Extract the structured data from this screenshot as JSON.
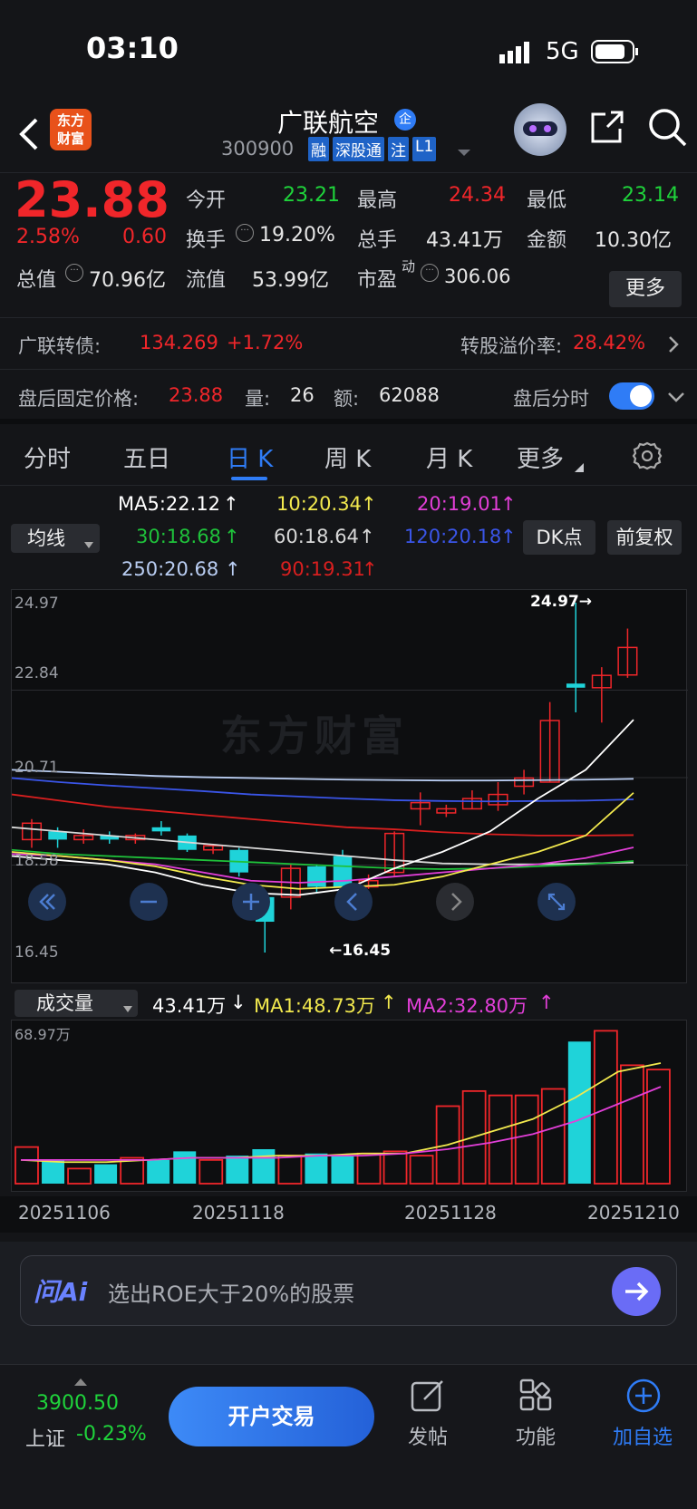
{
  "status": {
    "time": "03:10",
    "network": "5G"
  },
  "header": {
    "logo_line1": "东方",
    "logo_line2": "财富",
    "stock_name": "广联航空",
    "badge": "企",
    "code": "300900",
    "tags": [
      "融",
      "深股通",
      "注",
      "L1"
    ]
  },
  "quote": {
    "price": "23.88",
    "change_pct": "2.58%",
    "change": "0.60",
    "open_label": "今开",
    "open": "23.21",
    "high_label": "最高",
    "high": "24.34",
    "low_label": "最低",
    "low": "23.14",
    "turnover_label": "换手",
    "turnover": "19.20%",
    "volume_label": "总手",
    "volume": "43.41万",
    "amount_label": "金额",
    "amount": "10.30亿",
    "mcap_label": "总值",
    "mcap": "70.96亿",
    "float_label": "流值",
    "float": "53.99亿",
    "pe_label": "市盈",
    "pe_sup": "动",
    "pe": "306.06",
    "more": "更多"
  },
  "bond": {
    "label": "广联转债:",
    "price": "134.269",
    "pct": "+1.72%",
    "premium_label": "转股溢价率:",
    "premium": "28.42%"
  },
  "after": {
    "label": "盘后固定价格:",
    "price": "23.88",
    "vol_label": "量:",
    "vol": "26",
    "amt_label": "额:",
    "amt": "62088",
    "toggle_label": "盘后分时"
  },
  "tabs": [
    "分时",
    "五日",
    "日 K",
    "周 K",
    "月 K",
    "更多"
  ],
  "ma": {
    "selector": "均线",
    "ma5": "MA5:22.12",
    "ma10": "10:20.34",
    "ma20": "20:19.01",
    "ma30": "30:18.68",
    "ma60": "60:18.64",
    "ma120": "120:20.18",
    "ma250": "250:20.68",
    "ma90": "90:19.31",
    "dk": "DK点",
    "adjust": "前复权"
  },
  "kaxis": {
    "y1": "24.97",
    "y2": "22.84",
    "y3": "20.71",
    "y4": "18.58",
    "y5": "16.45",
    "max_marker": "24.97",
    "min_marker": "16.45",
    "watermark": "东方财富"
  },
  "volume": {
    "selector": "成交量",
    "current": "43.41万",
    "ma1": "MA1:48.73万",
    "ma2": "MA2:32.80万",
    "axis_max": "68.97万"
  },
  "dates": [
    "20251106",
    "20251118",
    "20251128",
    "20251210"
  ],
  "ai": {
    "logo": "问Ai",
    "placeholder": "选出ROE大于20%的股票"
  },
  "bottom": {
    "index_value": "3900.50",
    "index_name": "上证",
    "index_pct": "-0.23%",
    "trade_btn": "开户交易",
    "post": "发帖",
    "func": "功能",
    "watch": "加自选"
  },
  "colors": {
    "up": "#f0262a",
    "down": "#1fd3d9",
    "accent": "#2f7cf6",
    "ma5": "#ffffff",
    "ma10": "#f2e94e",
    "ma20": "#e23fd8",
    "ma30": "#1fc23b",
    "ma60": "#d8d8d8",
    "ma120": "#3a55e8",
    "ma250": "#b9cdf2",
    "ma90": "#d91f1f"
  },
  "chart_data": {
    "type": "candlestick",
    "title": "",
    "y_range": [
      16.45,
      24.97
    ],
    "candles": [
      {
        "o": 19.6,
        "c": 19.2,
        "h": 19.7,
        "l": 19.0,
        "up": true
      },
      {
        "o": 19.4,
        "c": 19.2,
        "h": 19.5,
        "l": 19.0,
        "up": false
      },
      {
        "o": 19.2,
        "c": 19.3,
        "h": 19.45,
        "l": 19.1,
        "up": true
      },
      {
        "o": 19.3,
        "c": 19.2,
        "h": 19.4,
        "l": 19.1,
        "up": false
      },
      {
        "o": 19.3,
        "c": 19.2,
        "h": 19.35,
        "l": 19.1,
        "up": true
      },
      {
        "o": 19.4,
        "c": 19.5,
        "h": 19.65,
        "l": 19.3,
        "up": false
      },
      {
        "o": 19.3,
        "c": 18.95,
        "h": 19.35,
        "l": 18.9,
        "up": false
      },
      {
        "o": 19.05,
        "c": 18.95,
        "h": 19.1,
        "l": 18.85,
        "up": true
      },
      {
        "o": 18.95,
        "c": 18.4,
        "h": 19.0,
        "l": 18.3,
        "up": false
      },
      {
        "o": 17.8,
        "c": 17.2,
        "h": 17.8,
        "l": 16.45,
        "up": false
      },
      {
        "o": 17.8,
        "c": 18.5,
        "h": 18.6,
        "l": 17.5,
        "up": true
      },
      {
        "o": 18.55,
        "c": 18.05,
        "h": 18.6,
        "l": 17.9,
        "up": false
      },
      {
        "o": 18.8,
        "c": 18.05,
        "h": 18.95,
        "l": 17.95,
        "up": false
      },
      {
        "o": 18.2,
        "c": 18.05,
        "h": 18.35,
        "l": 18.0,
        "up": true
      },
      {
        "o": 18.4,
        "c": 19.35,
        "h": 19.4,
        "l": 18.3,
        "up": true
      },
      {
        "o": 19.95,
        "c": 20.1,
        "h": 20.35,
        "l": 19.55,
        "up": true
      },
      {
        "o": 19.85,
        "c": 19.95,
        "h": 20.05,
        "l": 19.75,
        "up": true
      },
      {
        "o": 19.95,
        "c": 20.2,
        "h": 20.4,
        "l": 19.95,
        "up": true
      },
      {
        "o": 20.05,
        "c": 20.3,
        "h": 20.6,
        "l": 19.9,
        "up": true
      },
      {
        "o": 20.5,
        "c": 20.7,
        "h": 20.9,
        "l": 20.3,
        "up": true
      },
      {
        "o": 20.6,
        "c": 22.1,
        "h": 22.55,
        "l": 20.6,
        "up": true
      },
      {
        "o": 23.0,
        "c": 22.9,
        "h": 24.97,
        "l": 22.3,
        "up": false
      },
      {
        "o": 22.9,
        "c": 23.2,
        "h": 23.4,
        "l": 22.05,
        "up": true
      },
      {
        "o": 23.21,
        "c": 23.88,
        "h": 24.34,
        "l": 23.14,
        "up": true
      }
    ],
    "volumes": [
      17,
      11,
      7,
      9,
      12,
      11,
      15,
      11,
      13,
      16,
      13,
      14,
      13,
      14,
      15,
      13,
      36,
      43,
      41,
      41,
      44,
      66,
      71,
      55,
      53
    ],
    "vol_max": 68.97
  }
}
